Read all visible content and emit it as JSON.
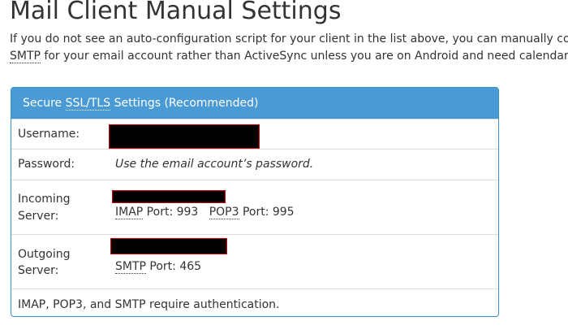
{
  "page": {
    "title": "Mail Client Manual Settings",
    "intro_line1": "If you do not see an auto-configuration script for your client in the list above, you can manually configure",
    "intro_abbr": "SMTP",
    "intro_line2_rest": " for your email account rather than ActiveSync unless you are on Android and need calendar and co"
  },
  "panel": {
    "heading_prefix": "Secure ",
    "heading_abbr": "SSL/TLS",
    "heading_suffix": " Settings (Recommended)",
    "username_label": "Username:",
    "password_label": "Password:",
    "password_value": "Use the email account’s password.",
    "incoming_label_1": "Incoming",
    "incoming_label_2": "Server:",
    "imap_abbr": "IMAP",
    "imap_port": " Port: 993",
    "pop3_abbr": "POP3",
    "pop3_port": " Port: 995",
    "outgoing_label_1": "Outgoing",
    "outgoing_label_2": "Server:",
    "smtp_abbr": "SMTP",
    "smtp_port": " Port: 465",
    "auth_note": "IMAP, POP3, and SMTP require authentication."
  },
  "colors": {
    "panel_heading_bg": "#4a9ad6",
    "panel_border": "#3c8ecf",
    "redaction": "#000000",
    "redaction_border": "#cc0000"
  }
}
